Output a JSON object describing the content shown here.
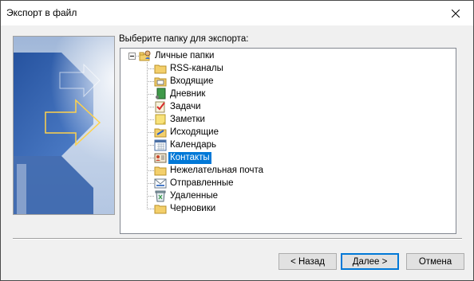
{
  "window": {
    "title": "Экспорт в файл"
  },
  "prompt": "Выберите папку для экспорта:",
  "tree": {
    "root": {
      "label": "Личные папки",
      "icon": "personal-folders-icon"
    },
    "items": [
      {
        "label": "RSS-каналы",
        "icon": "folder-icon",
        "selected": false
      },
      {
        "label": "Входящие",
        "icon": "inbox-icon",
        "selected": false
      },
      {
        "label": "Дневник",
        "icon": "journal-icon",
        "selected": false
      },
      {
        "label": "Задачи",
        "icon": "tasks-icon",
        "selected": false
      },
      {
        "label": "Заметки",
        "icon": "notes-icon",
        "selected": false
      },
      {
        "label": "Исходящие",
        "icon": "outbox-icon",
        "selected": false
      },
      {
        "label": "Календарь",
        "icon": "calendar-icon",
        "selected": false
      },
      {
        "label": "Контакты",
        "icon": "contacts-icon",
        "selected": true
      },
      {
        "label": "Нежелательная почта",
        "icon": "folder-icon",
        "selected": false
      },
      {
        "label": "Отправленные",
        "icon": "sent-items-icon",
        "selected": false
      },
      {
        "label": "Удаленные",
        "icon": "deleted-items-icon",
        "selected": false
      },
      {
        "label": "Черновики",
        "icon": "folder-icon",
        "selected": false
      }
    ]
  },
  "buttons": {
    "back": "< Назад",
    "next": "Далее >",
    "cancel": "Отмена"
  },
  "colors": {
    "selection": "#0078d7",
    "dialog_bg": "#f0f0f0",
    "banner_blue": "#2a5aa8"
  }
}
